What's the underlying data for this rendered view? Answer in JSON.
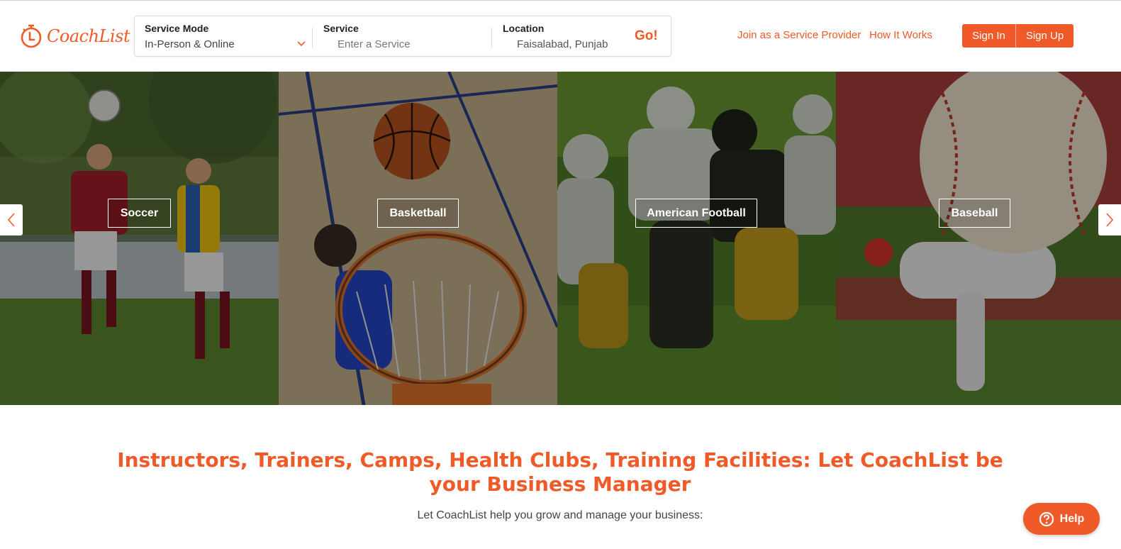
{
  "brand": {
    "name": "CoachList",
    "accent_color": "#f05a28"
  },
  "search": {
    "mode_label": "Service Mode",
    "mode_value": "In-Person & Online",
    "service_label": "Service",
    "service_placeholder": "Enter a Service",
    "location_label": "Location",
    "location_value": "Faisalabad, Punjab",
    "go_label": "Go!"
  },
  "nav": {
    "join_label": "Join as a Service Provider",
    "how_label": "How It Works",
    "signin_label": "Sign In",
    "signup_label": "Sign Up"
  },
  "carousel": {
    "tiles": [
      {
        "label": "Soccer"
      },
      {
        "label": "Basketball"
      },
      {
        "label": "American Football"
      },
      {
        "label": "Baseball"
      }
    ],
    "prev_icon": "chevron-left-icon",
    "next_icon": "chevron-right-icon"
  },
  "content": {
    "headline": "Instructors, Trainers, Camps, Health Clubs, Training Facilities: Let CoachList be your Business Manager",
    "subline": "Let CoachList help you grow and manage your business:"
  },
  "help": {
    "label": "Help",
    "icon": "question-circle-icon"
  }
}
